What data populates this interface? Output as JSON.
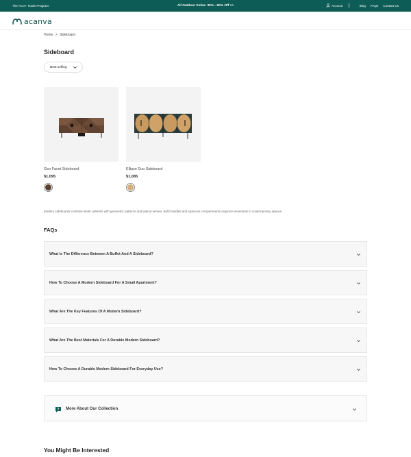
{
  "topbar": {
    "left_text": "The ACV+ Trade Program",
    "promo": "All Outdoor Sofas: 30% - 60% Off >>",
    "account": "Account",
    "links": [
      "Blog",
      "FAQs",
      "Contact Us"
    ],
    "bg_color": "#0d5c56"
  },
  "header": {
    "logo_text": "acanva",
    "logo_icon": "acanva-logo-icon"
  },
  "breadcrumb": {
    "home": "Home",
    "separator": ">",
    "current": "Sideboard"
  },
  "page": {
    "title": "Sideboard"
  },
  "sort": {
    "selected": "Best selling"
  },
  "products": [
    {
      "name": "Geo Facet Sideboard",
      "price": "$1,095",
      "swatch_color": "#5a3e2e"
    },
    {
      "name": "Ellipse Duo Sideboard",
      "price": "$1,085",
      "swatch_color": "#d4b07c"
    }
  ],
  "description": "Modern sideboards combine sleek cabinets with geometric patterns and walnut veneer. Bold handles and spacious compartments organize essentials in contemporary spaces.",
  "faq": {
    "title": "FAQs",
    "items": [
      {
        "question": "What Is The Difference Between A Buffet And A Sideboard?"
      },
      {
        "question": "How To Choose A Modern Sideboard For A Small Apartment?"
      },
      {
        "question": "What Are The Key Features Of A Modern Sideboard?"
      },
      {
        "question": "What Are The Best Materials For A Durable Modern Sideboard?"
      },
      {
        "question": "How To Choose A Durable Modern Sideboard For Everyday Use?"
      }
    ]
  },
  "more": {
    "label": "More About Our Collection",
    "icon": "question-chat-icon"
  },
  "interested": {
    "title": "You Might Be Interested"
  }
}
